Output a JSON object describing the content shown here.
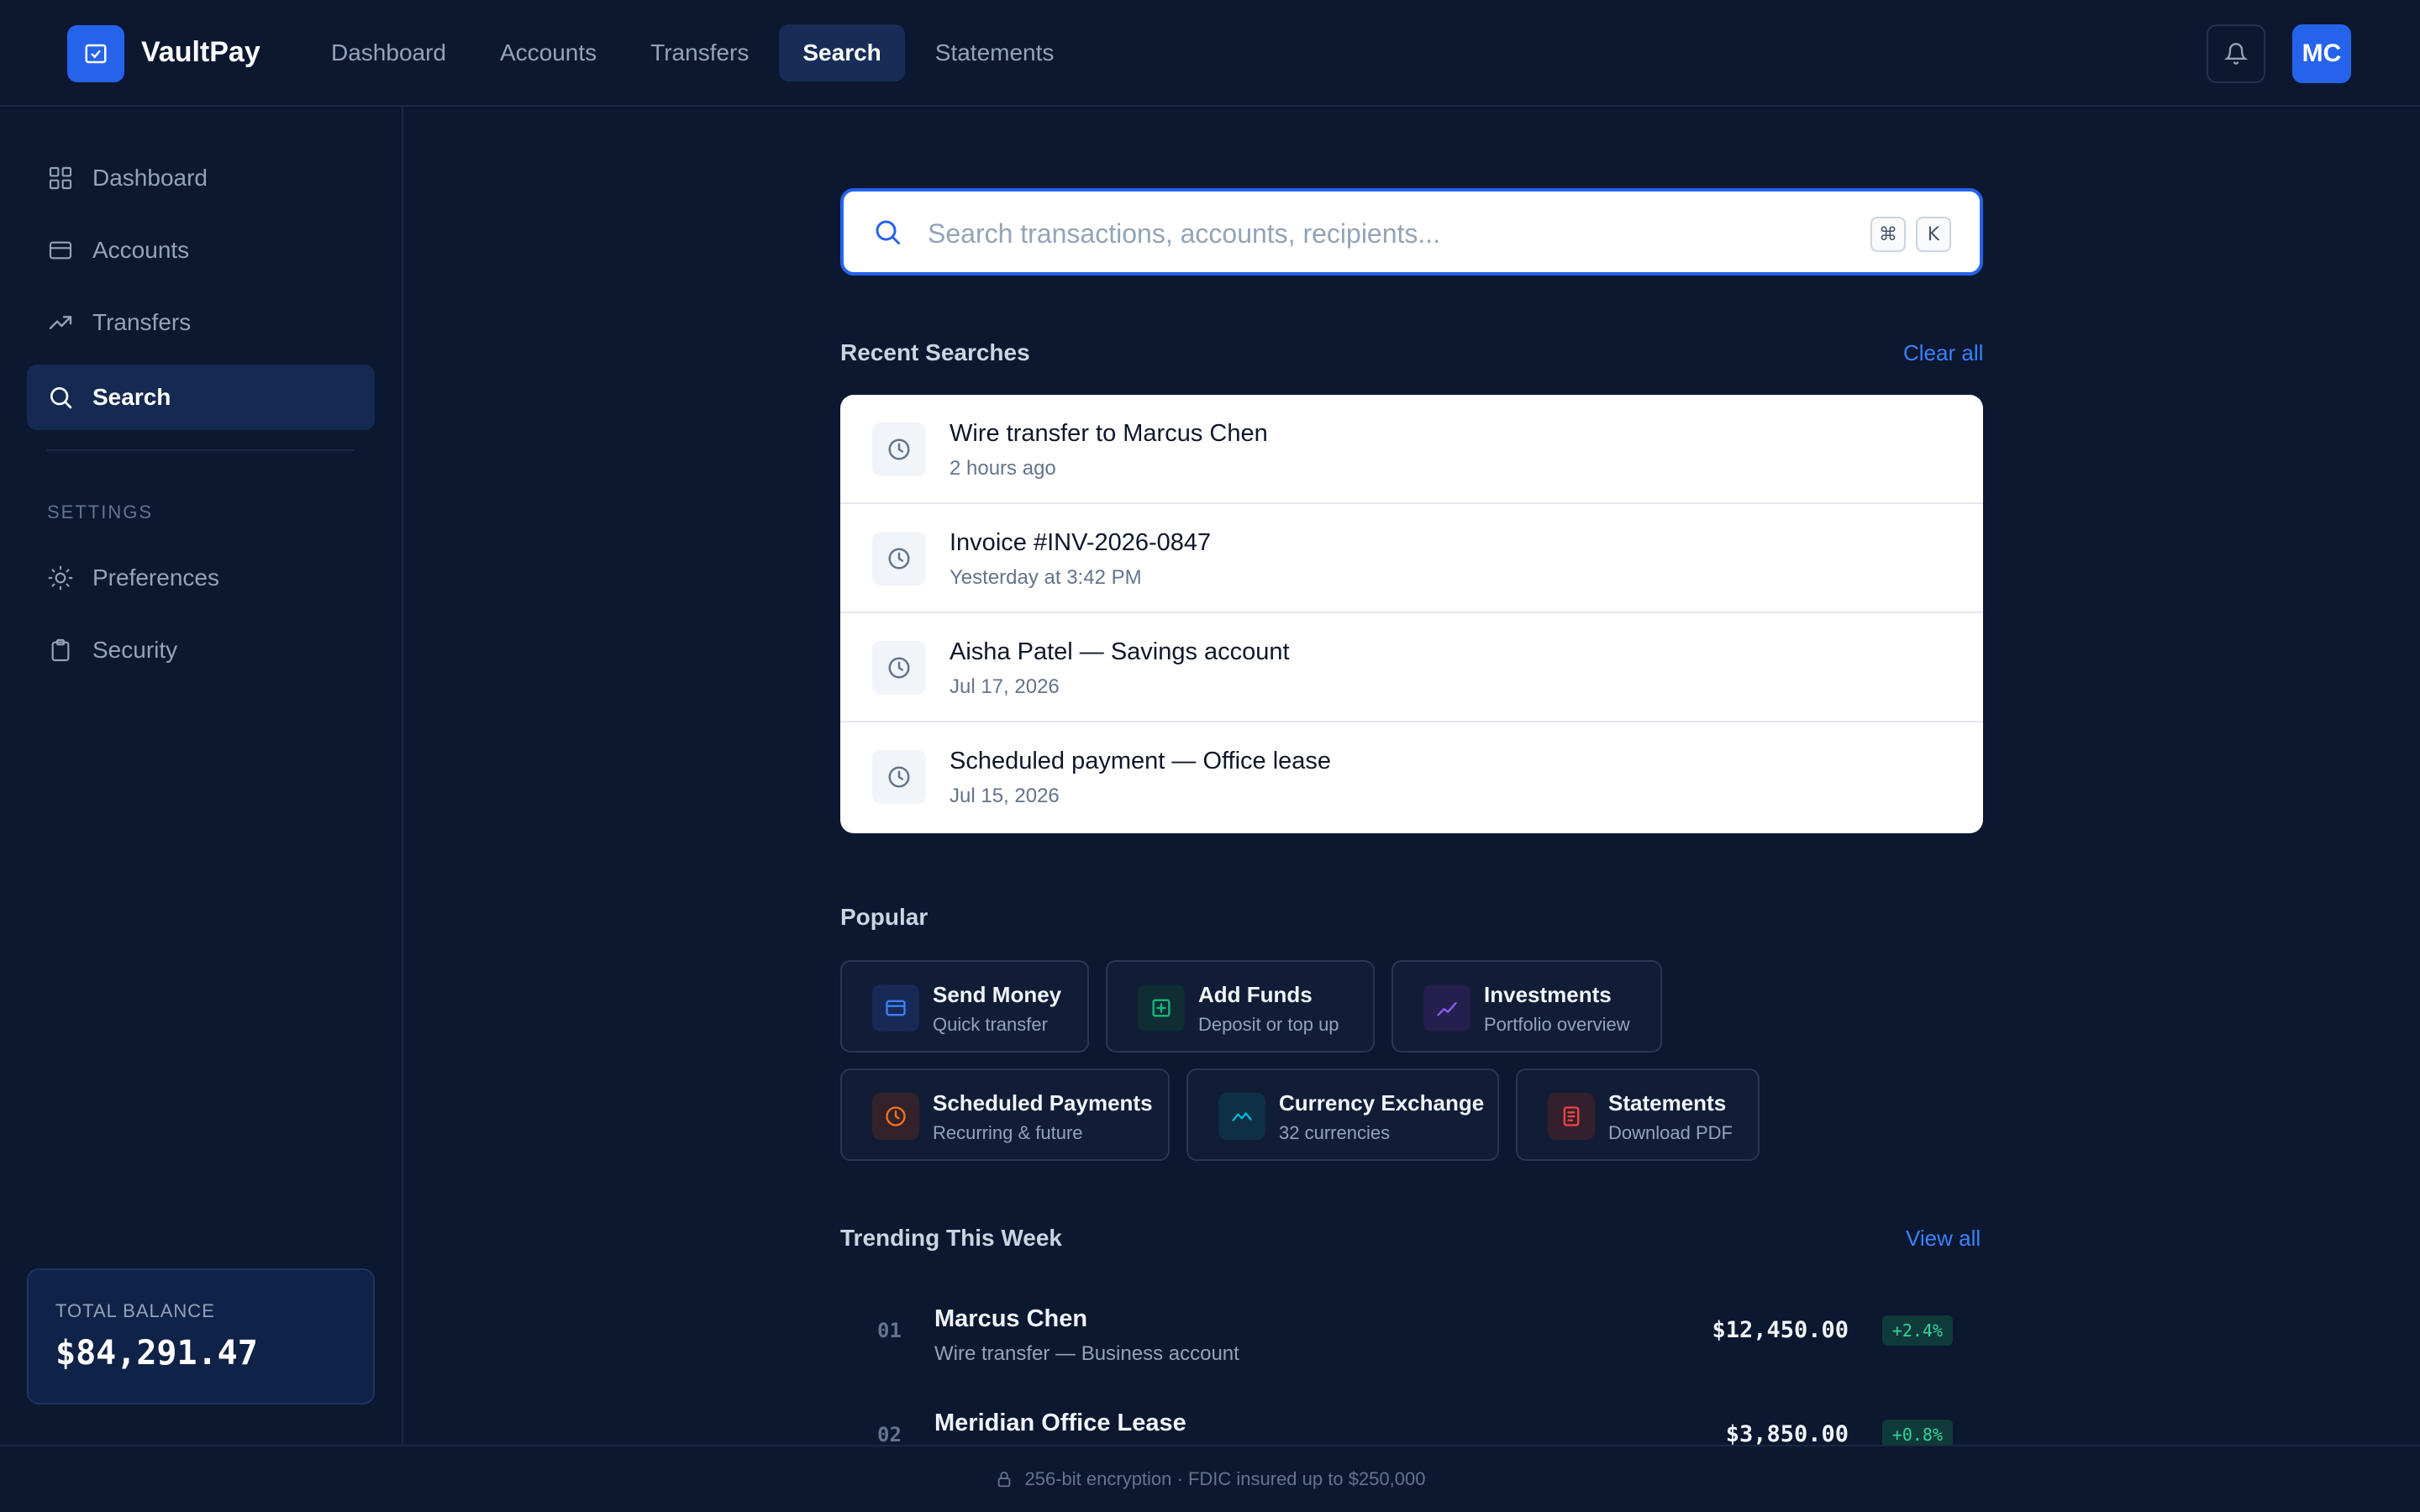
{
  "brand": {
    "name": "VaultPay"
  },
  "topnav": {
    "tabs": [
      {
        "label": "Dashboard",
        "active": false
      },
      {
        "label": "Accounts",
        "active": false
      },
      {
        "label": "Transfers",
        "active": false
      },
      {
        "label": "Search",
        "active": true
      },
      {
        "label": "Statements",
        "active": false
      }
    ]
  },
  "user": {
    "initials": "MC"
  },
  "sidebar": {
    "items": [
      {
        "label": "Dashboard",
        "icon": "grid-icon"
      },
      {
        "label": "Accounts",
        "icon": "card-icon"
      },
      {
        "label": "Transfers",
        "icon": "trending-icon"
      },
      {
        "label": "Search",
        "icon": "search-icon",
        "active": true
      }
    ],
    "section_label": "SETTINGS",
    "settings_items": [
      {
        "label": "Preferences",
        "icon": "sun-icon"
      },
      {
        "label": "Security",
        "icon": "clipboard-icon"
      }
    ],
    "balance": {
      "label": "TOTAL BALANCE",
      "value": "$84,291.47"
    }
  },
  "search": {
    "placeholder": "Search transactions, accounts, recipients...",
    "value": "",
    "shortcut": [
      "⌘",
      "K"
    ]
  },
  "recent": {
    "title": "Recent Searches",
    "clear_label": "Clear all",
    "items": [
      {
        "title": "Wire transfer to Marcus Chen",
        "time": "2 hours ago"
      },
      {
        "title": "Invoice #INV-2026-0847",
        "time": "Yesterday at 3:42 PM"
      },
      {
        "title": "Aisha Patel — Savings account",
        "time": "Jul 17, 2026"
      },
      {
        "title": "Scheduled payment — Office lease",
        "time": "Jul 15, 2026"
      }
    ]
  },
  "popular": {
    "title": "Popular",
    "items": [
      {
        "title": "Send Money",
        "sub": "Quick transfer",
        "icon": "card-icon",
        "color": "#3b82f6",
        "bg": "#172a55"
      },
      {
        "title": "Add Funds",
        "sub": "Deposit or top up",
        "icon": "plus-square-icon",
        "color": "#10b981",
        "bg": "#0f2d33"
      },
      {
        "title": "Investments",
        "sub": "Portfolio overview",
        "icon": "chart-line-icon",
        "color": "#8b5cf6",
        "bg": "#251f4d"
      },
      {
        "title": "Scheduled Payments",
        "sub": "Recurring & future",
        "icon": "clock-icon",
        "color": "#f97316",
        "bg": "#33222a"
      },
      {
        "title": "Currency Exchange",
        "sub": "32 currencies",
        "icon": "wave-icon",
        "color": "#06b6d4",
        "bg": "#0e2f45"
      },
      {
        "title": "Statements",
        "sub": "Download PDF",
        "icon": "document-icon",
        "color": "#ef4444",
        "bg": "#33202c"
      }
    ]
  },
  "trending": {
    "title": "Trending This Week",
    "view_label": "View all",
    "items": [
      {
        "rank": "01",
        "name": "Marcus Chen",
        "sub": "Wire transfer — Business account",
        "amount": "$12,450.00",
        "change": "+2.4%"
      },
      {
        "rank": "02",
        "name": "Meridian Office Lease",
        "sub": "",
        "amount": "$3,850.00",
        "change": "+0.8%"
      }
    ]
  },
  "footer": {
    "text": "256-bit encryption · FDIC insured up to $250,000"
  }
}
